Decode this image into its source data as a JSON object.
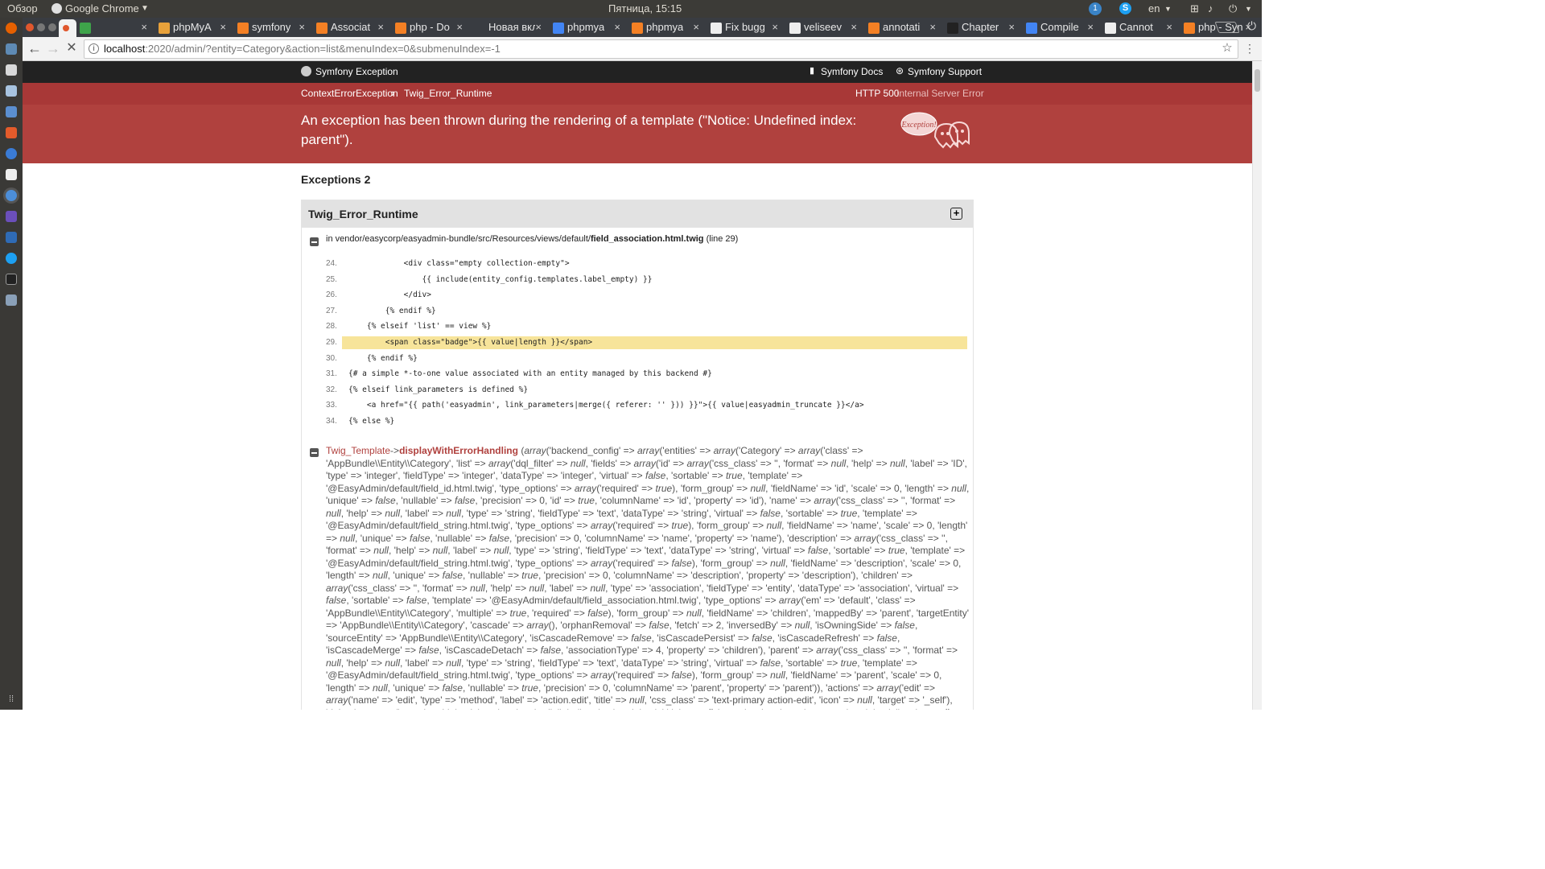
{
  "os_panel": {
    "activities": "Обзор",
    "app_name": "Google Chrome",
    "clock": "Пятница, 15:15",
    "notification_count": "1",
    "language": "en"
  },
  "browser": {
    "tabs": [
      {
        "title": "",
        "active": true,
        "favicon_color": "#e0572d"
      },
      {
        "title": "",
        "active": false,
        "favicon_color": "#3ea34a"
      },
      {
        "title": "phpMyA",
        "active": false,
        "favicon_color": "#e8a13a"
      },
      {
        "title": "symfony",
        "active": false,
        "favicon_color": "#f48024"
      },
      {
        "title": "Associat",
        "active": false,
        "favicon_color": "#f48024"
      },
      {
        "title": "php - Do",
        "active": false,
        "favicon_color": "#f48024"
      },
      {
        "title": "Новая вкла",
        "active": false,
        "favicon_color": ""
      },
      {
        "title": "phpmya",
        "active": false,
        "favicon_color": "#4285f4"
      },
      {
        "title": "phpmya",
        "active": false,
        "favicon_color": "#f48024"
      },
      {
        "title": "Fix bugg",
        "active": false,
        "favicon_color": "#eeeeee"
      },
      {
        "title": "veliseev",
        "active": false,
        "favicon_color": "#eeeeee"
      },
      {
        "title": "annotati",
        "active": false,
        "favicon_color": "#f48024"
      },
      {
        "title": "Chapter",
        "active": false,
        "favicon_color": "#222222"
      },
      {
        "title": "Compile",
        "active": false,
        "favicon_color": "#4285f4"
      },
      {
        "title": "Cannot",
        "active": false,
        "favicon_color": "#eeeeee"
      },
      {
        "title": "php - Syn",
        "active": false,
        "favicon_color": "#f48024"
      }
    ],
    "url_host": "localhost",
    "url_rest": ":2020/admin/?entity=Category&action=list&menuIndex=0&submenuIndex=-1"
  },
  "page": {
    "header": {
      "brand": "Symfony Exception",
      "docs_link": "Symfony Docs",
      "support_link": "Symfony Support"
    },
    "breadcrumb": {
      "first": "ContextErrorException",
      "second": "Twig_Error_Runtime",
      "status_code": "HTTP 500",
      "status_text": "Internal Server Error"
    },
    "message": "An exception has been thrown during the rendering of a template (\"Notice: Undefined index: parent\").",
    "ghost_label": "Exception!",
    "exceptions_heading": "Exceptions 2",
    "panel": {
      "title": "Twig_Error_Runtime",
      "location_prefix": "in vendor/easycorp/easyadmin-bundle/src/Resources/views/default/",
      "location_file": "field_association.html.twig",
      "location_suffix": "(line 29)",
      "code_lines": [
        {
          "num": "24.",
          "code": "            <div class=\"empty collection-empty\">",
          "highlight": false
        },
        {
          "num": "25.",
          "code": "                {{ include(entity_config.templates.label_empty) }}",
          "highlight": false
        },
        {
          "num": "26.",
          "code": "            </div>",
          "highlight": false
        },
        {
          "num": "27.",
          "code": "        {% endif %}",
          "highlight": false
        },
        {
          "num": "28.",
          "code": "    {% elseif 'list' == view %}",
          "highlight": false
        },
        {
          "num": "29.",
          "code": "        <span class=\"badge\">{{ value|length }}</span>",
          "highlight": true
        },
        {
          "num": "30.",
          "code": "    {% endif %}",
          "highlight": false
        },
        {
          "num": "31.",
          "code": "{# a simple *-to-one value associated with an entity managed by this backend #}",
          "highlight": false
        },
        {
          "num": "32.",
          "code": "{% elseif link_parameters is defined %}",
          "highlight": false
        },
        {
          "num": "33.",
          "code": "    <a href=\"{{ path('easyadmin', link_parameters|merge({ referer: '' })) }}\">{{ value|easyadmin_truncate }}</a>",
          "highlight": false
        },
        {
          "num": "34.",
          "code": "{% else %}",
          "highlight": false
        }
      ],
      "trace_class": "Twig_Template",
      "trace_arrow": "->",
      "trace_method": "displayWithErrorHandling",
      "trace_args": "(array('backend_config' => array('entities' => array('Category' => array('class' => 'AppBundle\\\\Entity\\\\Category', 'list' => array('dql_filter' => null, 'fields' => array('id' => array('css_class' => '', 'format' => null, 'help' => null, 'label' => 'ID', 'type' => 'integer', 'fieldType' => 'integer', 'dataType' => 'integer', 'virtual' => false, 'sortable' => true, 'template' => '@EasyAdmin/default/field_id.html.twig', 'type_options' => array('required' => true), 'form_group' => null, 'fieldName' => 'id', 'scale' => 0, 'length' => null, 'unique' => false, 'nullable' => false, 'precision' => 0, 'id' => true, 'columnName' => 'id', 'property' => 'id'), 'name' => array('css_class' => '', 'format' => null, 'help' => null, 'label' => null, 'type' => 'string', 'fieldType' => 'text', 'dataType' => 'string', 'virtual' => false, 'sortable' => true, 'template' => '@EasyAdmin/default/field_string.html.twig', 'type_options' => array('required' => true), 'form_group' => null, 'fieldName' => 'name', 'scale' => 0, 'length' => null, 'unique' => false, 'nullable' => false, 'precision' => 0, 'columnName' => 'name', 'property' => 'name'), 'description' => array('css_class' => '', 'format' => null, 'help' => null, 'label' => null, 'type' => 'string', 'fieldType' => 'text', 'dataType' => 'string', 'virtual' => false, 'sortable' => true, 'template' => '@EasyAdmin/default/field_string.html.twig', 'type_options' => array('required' => false), 'form_group' => null, 'fieldName' => 'description', 'scale' => 0, 'length' => null, 'unique' => false, 'nullable' => true, 'precision' => 0, 'columnName' => 'description', 'property' => 'description'), 'children' => array('css_class' => '', 'format' => null, 'help' => null, 'label' => null, 'type' => 'association', 'fieldType' => 'entity', 'dataType' => 'association', 'virtual' => false, 'sortable' => false, 'template' => '@EasyAdmin/default/field_association.html.twig', 'type_options' => array('em' => 'default', 'class' => 'AppBundle\\\\Entity\\\\Category', 'multiple' => true, 'required' => false), 'form_group' => null, 'fieldName' => 'children', 'mappedBy' => 'parent', 'targetEntity' => 'AppBundle\\\\Entity\\\\Category', 'cascade' => array(), 'orphanRemoval' => false, 'fetch' => 2, 'inversedBy' => null, 'isOwningSide' => false, 'sourceEntity' => 'AppBundle\\\\Entity\\\\Category', 'isCascadeRemove' => false, 'isCascadePersist' => false, 'isCascadeRefresh' => false, 'isCascadeMerge' => false, 'isCascadeDetach' => false, 'associationType' => 4, 'property' => 'children'), 'parent' => array('css_class' => '', 'format' => null, 'help' => null, 'label' => null, 'type' => 'string', 'fieldType' => 'text', 'dataType' => 'string', 'virtual' => false, 'sortable' => true, 'template' => '@EasyAdmin/default/field_string.html.twig', 'type_options' => array('required' => false), 'form_group' => null, 'fieldName' => 'parent', 'scale' => 0, 'length' => null, 'unique' => false, 'nullable' => true, 'precision' => 0, 'columnName' => 'parent', 'property' => 'parent')), 'actions' => array('edit' => array('name' => 'edit', 'type' => 'method', 'label' => 'action.edit', 'title' => null, 'css_class' => 'text-primary action-edit', 'icon' => null, 'target' => '_self'), 'delete' => array('name' => 'delete', 'type' => 'method', 'label' => 'action.delete', 'title' => null, 'css_class' => 'text-danger action-delete', 'icon' => null, 'target' => '_self'), 'new' => array('name' => 'new', 'type' => 'method', 'label'"
    }
  },
  "colors": {
    "header_bg": "#222222",
    "error_bar": "#a83837",
    "error_msg_bg": "#b0413e",
    "highlight_line": "#f7e49a"
  }
}
